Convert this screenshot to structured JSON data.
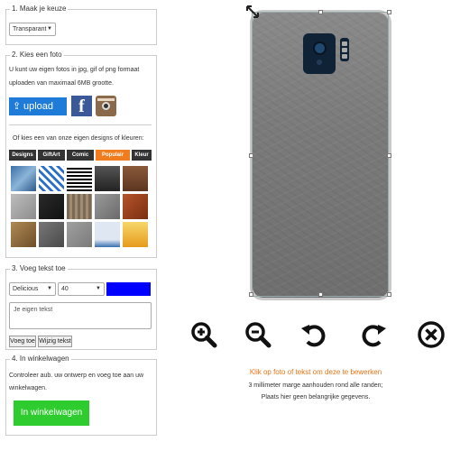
{
  "step1": {
    "title": "1. Maak je keuze",
    "selected": "Transparant"
  },
  "step2": {
    "title": "2. Kies een foto",
    "info_line1": "U kunt uw eigen fotos in jpg, gif of png formaat",
    "info_line2": "uploaden van maximaal 6MB grootte.",
    "upload_label": "upload",
    "facebook_glyph": "f",
    "designs_prompt": "Of kies een van onze eigen designs of kleuren:",
    "categories": [
      "Designs",
      "GiftArt",
      "Comic",
      "Populair",
      "Kleur"
    ],
    "active_category": "Populair"
  },
  "step3": {
    "title": "3. Voeg tekst toe",
    "font": "Delicious",
    "size": "40",
    "color": "#0000ff",
    "text_placeholder": "Je eigen tekst",
    "add_label": "Voeg toe",
    "edit_label": "Wijzig tekst"
  },
  "step4": {
    "title": "4. In winkelwagen",
    "info_line1": "Controleer aub. uw ontwerp en voeg toe aan uw",
    "info_line2": "winkelwagen.",
    "cart_label": "In winkelwagen"
  },
  "editor": {
    "hint": "Klik op foto of tekst om deze te bewerken",
    "note1": "3 millimeter marge aanhouden rond alle randen;",
    "note2": "Plaats hier geen belangrijke gegevens.",
    "tools": [
      "zoom-in-icon",
      "zoom-out-icon",
      "rotate-left-icon",
      "rotate-right-icon",
      "delete-icon"
    ]
  }
}
